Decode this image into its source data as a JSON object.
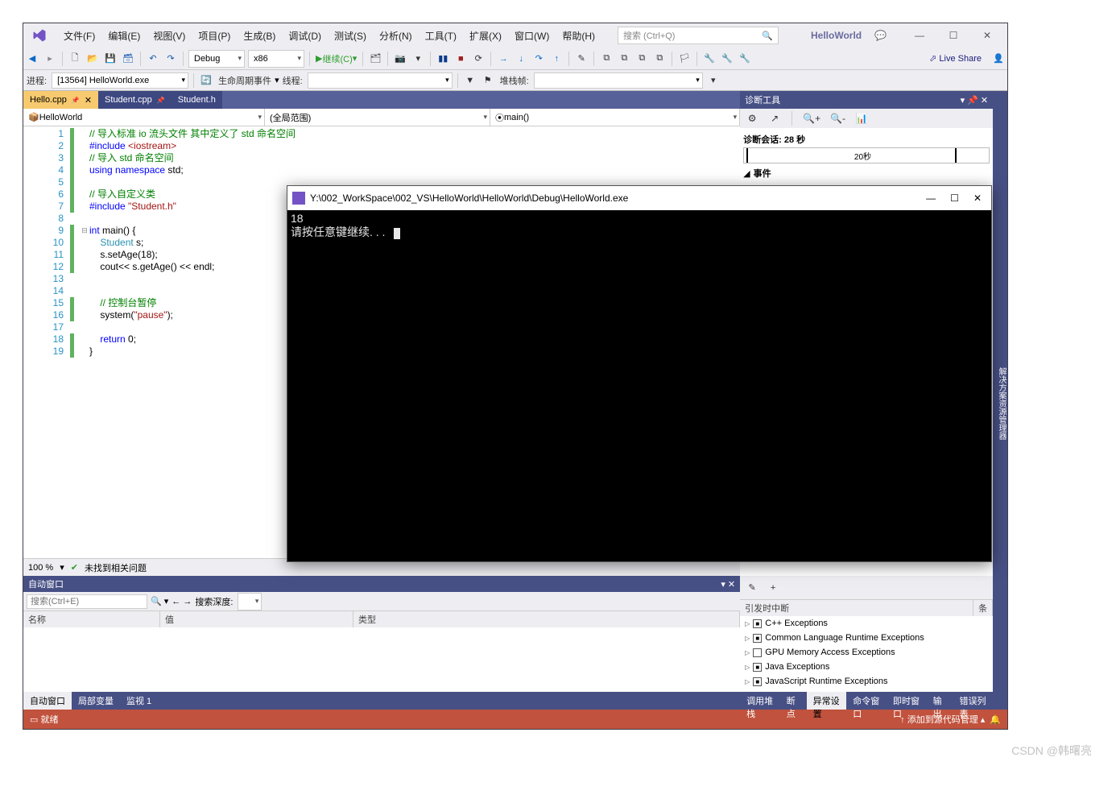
{
  "menu": {
    "file": "文件(F)",
    "edit": "编辑(E)",
    "view": "视图(V)",
    "project": "项目(P)",
    "build": "生成(B)",
    "debug": "调试(D)",
    "test": "测试(S)",
    "analyze": "分析(N)",
    "tools": "工具(T)",
    "extensions": "扩展(X)",
    "window": "窗口(W)",
    "help": "帮助(H)"
  },
  "search_placeholder": "搜索 (Ctrl+Q)",
  "project_name": "HelloWorld",
  "live_share": "Live Share",
  "toolbar": {
    "config": "Debug",
    "platform": "x86",
    "continue": "继续(C)"
  },
  "debugbar": {
    "process_label": "进程:",
    "process": "[13564] HelloWorld.exe",
    "lifecycle": "生命周期事件",
    "thread_label": "线程:",
    "stackframe": "堆栈帧:"
  },
  "tabs": [
    {
      "name": "Hello.cpp",
      "active": true,
      "pinned": true
    },
    {
      "name": "Student.cpp",
      "active": false,
      "pinned": true
    },
    {
      "name": "Student.h",
      "active": false,
      "pinned": false
    }
  ],
  "codenav": {
    "scope": "HelloWorld",
    "scope2": "(全局范围)",
    "func": "main()"
  },
  "code": {
    "lines": [
      {
        "n": 1,
        "mark": true,
        "html": "<span class='c-comment'>// 导入标准 io 流头文件 其中定义了 std 命名空间</span>"
      },
      {
        "n": 2,
        "mark": true,
        "html": "<span class='c-keyword'>#include</span> <span class='c-string'>&lt;iostream&gt;</span>"
      },
      {
        "n": 3,
        "mark": true,
        "html": "<span class='c-comment'>// 导入 std 命名空间</span>"
      },
      {
        "n": 4,
        "mark": true,
        "html": "<span class='c-keyword'>using</span> <span class='c-keyword'>namespace</span> std;"
      },
      {
        "n": 5,
        "mark": true,
        "html": ""
      },
      {
        "n": 6,
        "mark": true,
        "html": "<span class='c-comment'>// 导入自定义类</span>"
      },
      {
        "n": 7,
        "mark": true,
        "html": "<span class='c-keyword'>#include</span> <span class='c-string'>\"Student.h\"</span>"
      },
      {
        "n": 8,
        "mark": false,
        "html": ""
      },
      {
        "n": 9,
        "mark": true,
        "fold": "⊟",
        "html": "<span class='c-keyword'>int</span> main() {"
      },
      {
        "n": 10,
        "mark": true,
        "html": "    <span class='c-type'>Student</span> s;"
      },
      {
        "n": 11,
        "mark": true,
        "html": "    s.setAge(18);"
      },
      {
        "n": 12,
        "mark": true,
        "html": "    cout&lt;&lt; s.getAge() &lt;&lt; endl;"
      },
      {
        "n": 13,
        "mark": false,
        "html": ""
      },
      {
        "n": 14,
        "mark": false,
        "html": ""
      },
      {
        "n": 15,
        "mark": true,
        "html": "    <span class='c-comment'>// 控制台暂停</span>"
      },
      {
        "n": 16,
        "mark": true,
        "html": "    system(<span class='c-string'>\"pause\"</span>);"
      },
      {
        "n": 17,
        "mark": false,
        "html": ""
      },
      {
        "n": 18,
        "mark": true,
        "html": "    <span class='c-keyword'>return</span> 0;"
      },
      {
        "n": 19,
        "mark": true,
        "html": "}"
      }
    ]
  },
  "editor_status": {
    "zoom": "100 %",
    "issues": "未找到相关问题"
  },
  "autowin": {
    "title": "自动窗口",
    "search": "搜索(Ctrl+E)",
    "depth": "搜索深度:",
    "cols": {
      "name": "名称",
      "value": "值",
      "type": "类型"
    }
  },
  "autowin_tabs": [
    "自动窗口",
    "局部变量",
    "监视 1"
  ],
  "excwin": {
    "cols": {
      "break": "引发时中断",
      "cond": "条件"
    },
    "rows": [
      {
        "chk": "■",
        "label": "C++ Exceptions"
      },
      {
        "chk": "■",
        "label": "Common Language Runtime Exceptions"
      },
      {
        "chk": "□",
        "label": "GPU Memory Access Exceptions"
      },
      {
        "chk": "■",
        "label": "Java Exceptions"
      },
      {
        "chk": "■",
        "label": "JavaScript Runtime Exceptions"
      }
    ]
  },
  "exc_tabs": [
    "调用堆栈",
    "断点",
    "异常设置",
    "命令窗口",
    "即时窗口",
    "输出",
    "错误列表"
  ],
  "exc_active": "异常设置",
  "diag": {
    "title": "诊断工具",
    "session": "诊断会话: 28 秒",
    "tick": "20秒",
    "events": "事件"
  },
  "side_strip": "解决方案资源管理器",
  "status": {
    "ready": "就绪",
    "add_src": "添加到源代码管理"
  },
  "console": {
    "title": "Y:\\002_WorkSpace\\002_VS\\HelloWorld\\HelloWorld\\Debug\\HelloWorld.exe",
    "out1": "18",
    "out2": "请按任意键继续. . ."
  },
  "watermark": "CSDN @韩曙亮"
}
